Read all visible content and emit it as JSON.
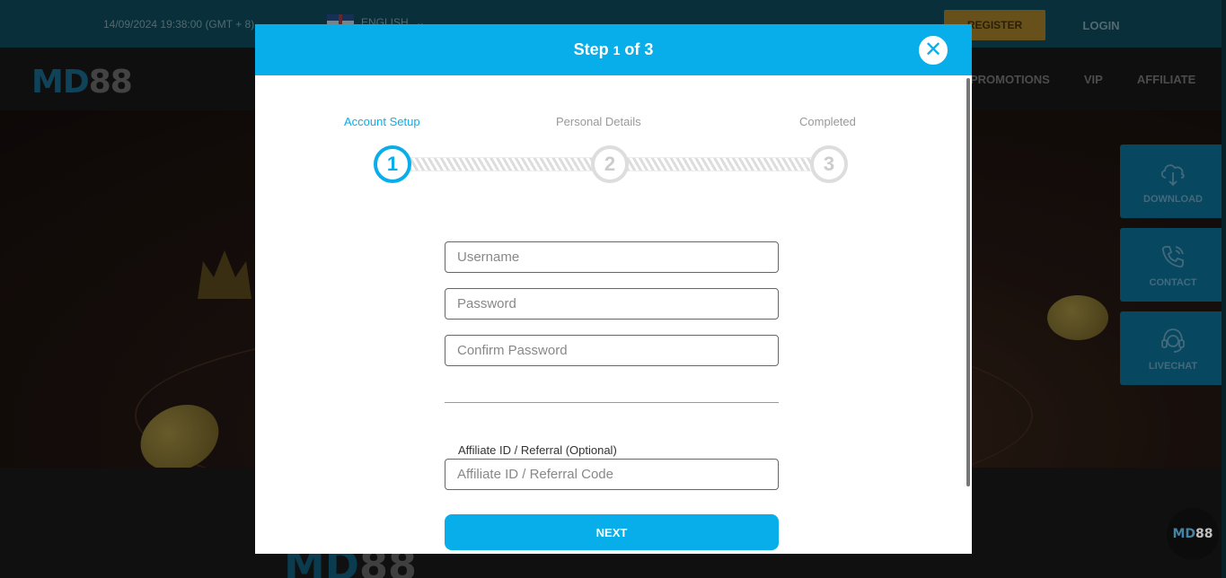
{
  "topbar": {
    "datetime": "14/09/2024 19:38:00 (GMT + 8)",
    "language": "ENGLISH",
    "register_label": "REGISTER",
    "login_label": "LOGIN"
  },
  "nav": {
    "logo_md": "MD",
    "logo_88": "88",
    "items": [
      "PROMOTIONS",
      "VIP",
      "AFFILIATE"
    ]
  },
  "side_widgets": [
    {
      "label": "DOWNLOAD",
      "icon": "cloud-download-icon"
    },
    {
      "label": "CONTACT",
      "icon": "phone-icon"
    },
    {
      "label": "LIVECHAT",
      "icon": "headset-icon"
    }
  ],
  "chat_bubble": {
    "md": "MD",
    "n88": "88"
  },
  "modal": {
    "title_prefix": "Step ",
    "title_step": "1",
    "title_suffix": " of 3",
    "close_symbol": "✕",
    "steps": [
      {
        "label": "Account Setup",
        "number": "1",
        "active": true
      },
      {
        "label": "Personal Details",
        "number": "2",
        "active": false
      },
      {
        "label": "Completed",
        "number": "3",
        "active": false
      }
    ],
    "fields": {
      "username_placeholder": "Username",
      "password_placeholder": "Password",
      "confirm_password_placeholder": "Confirm Password",
      "affiliate_label": "Affiliate ID / Referral (Optional)",
      "affiliate_placeholder": "Affiliate ID / Referral Code"
    },
    "next_label": "NEXT"
  },
  "colors": {
    "accent": "#08aee9",
    "topbar_bg": "#0b3f4e",
    "register_bg": "#8a6b22",
    "side_widget_bg": "#0b5f80"
  }
}
